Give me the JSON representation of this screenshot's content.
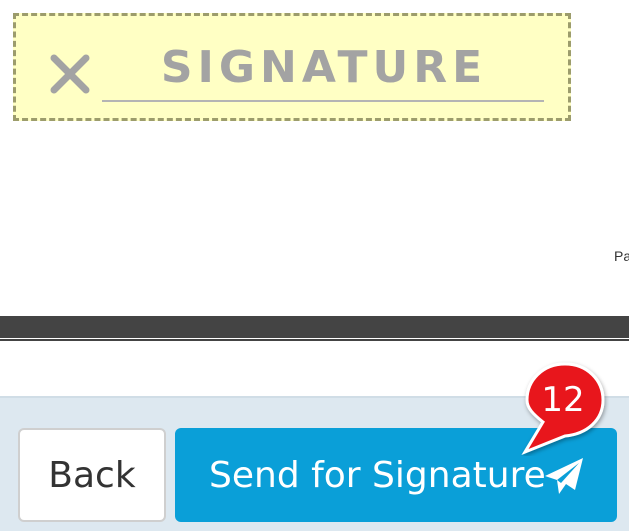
{
  "signature_field": {
    "label": "SIGNATURE",
    "remove_icon": "close-icon",
    "background_color": "#ffffc4",
    "border_color": "#9c9c6c"
  },
  "document": {
    "page_marker": "Pa"
  },
  "actions": {
    "back_label": "Back",
    "send_label": "Send for Signature",
    "send_icon": "paper-plane-icon",
    "send_color": "#0a9fd8"
  },
  "tutorial": {
    "step_number": "12",
    "badge_color": "#e8141a"
  }
}
